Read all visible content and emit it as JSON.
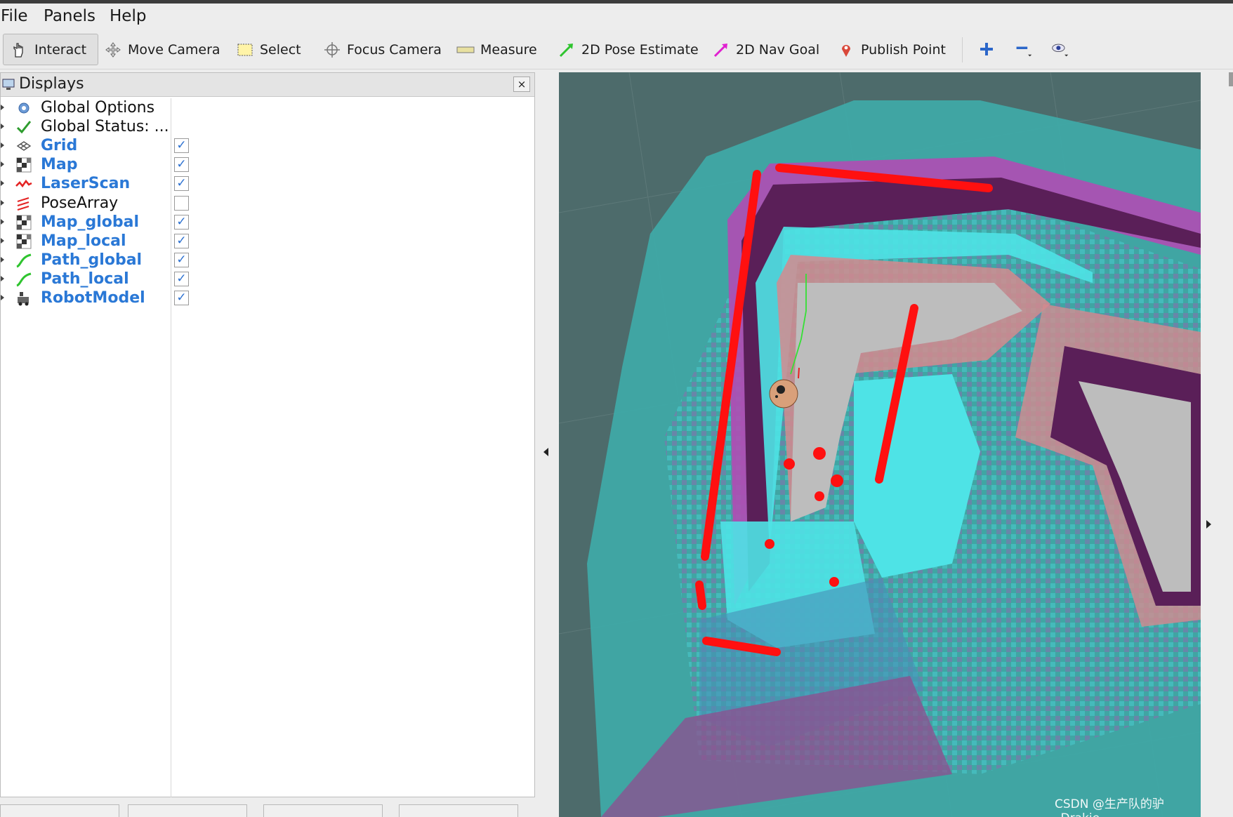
{
  "menu": {
    "items": [
      "File",
      "Panels",
      "Help"
    ]
  },
  "toolbar": {
    "tools": [
      {
        "label": "Interact",
        "icon": "hand-icon"
      },
      {
        "label": "Move Camera",
        "icon": "move-camera-icon"
      },
      {
        "label": "Select",
        "icon": "select-box-icon"
      },
      {
        "label": "Focus Camera",
        "icon": "focus-camera-icon"
      },
      {
        "label": "Measure",
        "icon": "ruler-icon"
      },
      {
        "label": "2D Pose Estimate",
        "icon": "green-arrow-icon"
      },
      {
        "label": "2D Nav Goal",
        "icon": "magenta-arrow-icon"
      },
      {
        "label": "Publish Point",
        "icon": "map-pin-icon"
      }
    ],
    "extra_icons": [
      "plus-icon",
      "minus-icon",
      "eye-icon"
    ]
  },
  "displays": {
    "title": "Displays",
    "close": "×",
    "rows": [
      {
        "label": "Global Options",
        "icon": "gear-icon",
        "enabled": false,
        "check": null
      },
      {
        "label": "Global Status: ...",
        "icon": "checkmark-icon",
        "enabled": false,
        "check": null
      },
      {
        "label": "Grid",
        "icon": "grid-icon",
        "enabled": true,
        "check": true
      },
      {
        "label": "Map",
        "icon": "map-icon",
        "enabled": true,
        "check": true
      },
      {
        "label": "LaserScan",
        "icon": "laserscan-icon",
        "enabled": true,
        "check": true
      },
      {
        "label": "PoseArray",
        "icon": "posearray-icon",
        "enabled": false,
        "check": false
      },
      {
        "label": "Map_global",
        "icon": "map-icon",
        "enabled": true,
        "check": true
      },
      {
        "label": "Map_local",
        "icon": "map-icon",
        "enabled": true,
        "check": true
      },
      {
        "label": "Path_global",
        "icon": "path-icon",
        "enabled": true,
        "check": true
      },
      {
        "label": "Path_local",
        "icon": "path-icon",
        "enabled": true,
        "check": true
      },
      {
        "label": "RobotModel",
        "icon": "robot-icon",
        "enabled": true,
        "check": true
      }
    ]
  },
  "viewport": {
    "watermark": "CSDN @生产队的驴_Drakie"
  },
  "colors": {
    "laser": "#ff1010",
    "path": "#35e035",
    "free": "#bdbdbd",
    "unknown": "#4d6b6b",
    "cyan": "#4ee3e6",
    "purple": "#b04db4",
    "dark_purple": "#5a1f58",
    "salmon": "#d58a8e"
  }
}
